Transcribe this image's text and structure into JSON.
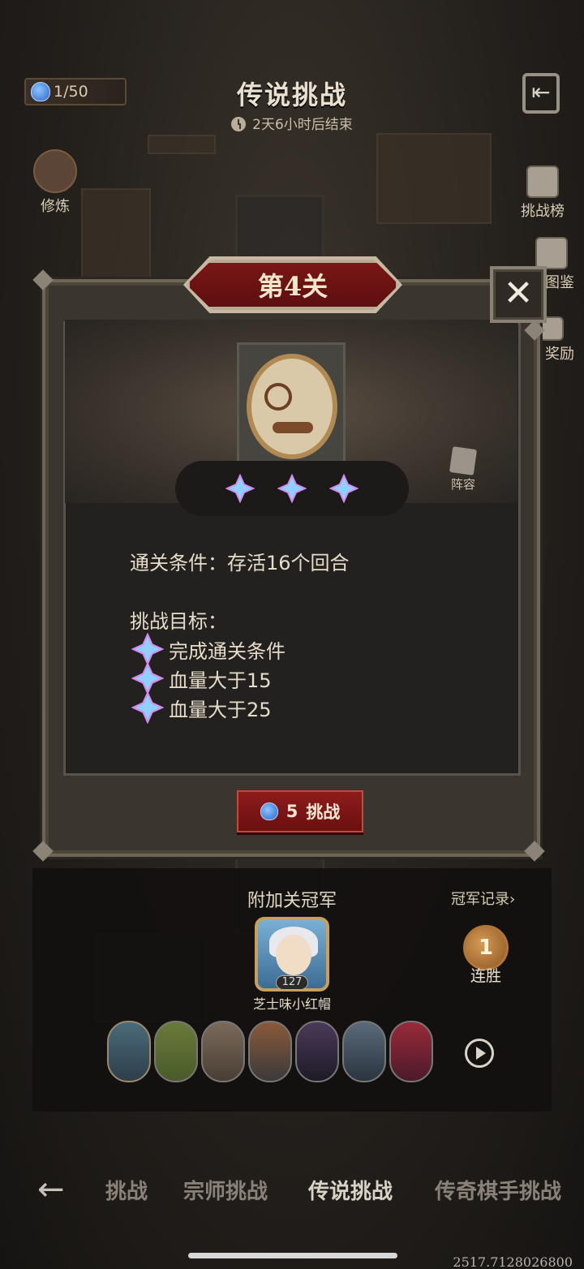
{
  "header": {
    "ticket_count": "1/50",
    "title": "传说挑战",
    "countdown": "2天6小时后结束"
  },
  "side_buttons": {
    "train": "修炼",
    "leaderboard": "挑战榜",
    "codex_partial": "图鉴",
    "reward_partial": "奖励"
  },
  "modal": {
    "level_title": "第4关",
    "lineup_label": "阵容",
    "clear_condition": "通关条件：存活16个回合",
    "goals_title": "挑战目标：",
    "goals": [
      "完成通关条件",
      "血量大于15",
      "血量大于25"
    ],
    "challenge_cost": "5",
    "challenge_label": "挑战"
  },
  "champion": {
    "title": "附加关冠军",
    "record_link": "冠军记录",
    "level": "127",
    "name": "芝士味小红帽",
    "streak_count": "1",
    "streak_label": "连胜"
  },
  "bottom_nav": {
    "tabs": [
      "挑战",
      "宗师挑战",
      "传说挑战",
      "传奇棋手挑战"
    ],
    "active_index": 2
  },
  "version": "2517.7128026800",
  "colors": {
    "accent_red": "#7a1616",
    "frame": "#6e6557",
    "star_blue": "#8fd0ff",
    "star_pink": "#d58cf0"
  }
}
